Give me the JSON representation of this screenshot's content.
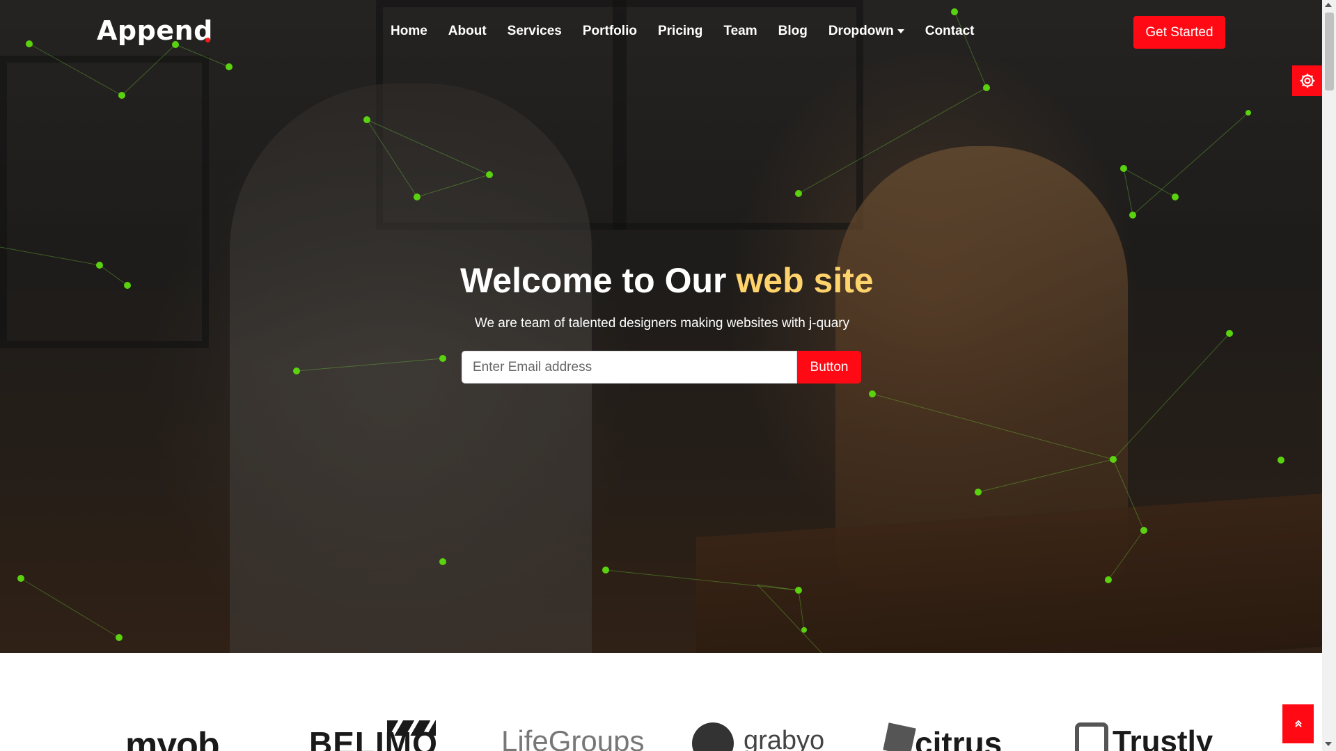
{
  "brand": {
    "name": "Append",
    "accent_color": "#ff0a14"
  },
  "nav": {
    "items": [
      {
        "label": "Home"
      },
      {
        "label": "About"
      },
      {
        "label": "Services"
      },
      {
        "label": "Portfolio"
      },
      {
        "label": "Pricing"
      },
      {
        "label": "Team"
      },
      {
        "label": "Blog"
      },
      {
        "label": "Dropdown",
        "has_caret": true
      },
      {
        "label": "Contact"
      }
    ],
    "cta_label": "Get Started"
  },
  "settings": {
    "icon": "gear-icon"
  },
  "hero": {
    "title_main": "Welcome to Our ",
    "title_accent": "web site",
    "subtitle": "We are team of talented designers making websites with j-quary",
    "email_placeholder": "Enter Email address",
    "button_label": "Button",
    "particle_color": "#5ad20f"
  },
  "clients": {
    "logos": [
      "myob",
      "BELIMO",
      "LifeGroups",
      "grabyo",
      "citrus",
      "Trustly"
    ]
  },
  "back_to_top": {
    "icon": "chevron-double-up-icon"
  }
}
